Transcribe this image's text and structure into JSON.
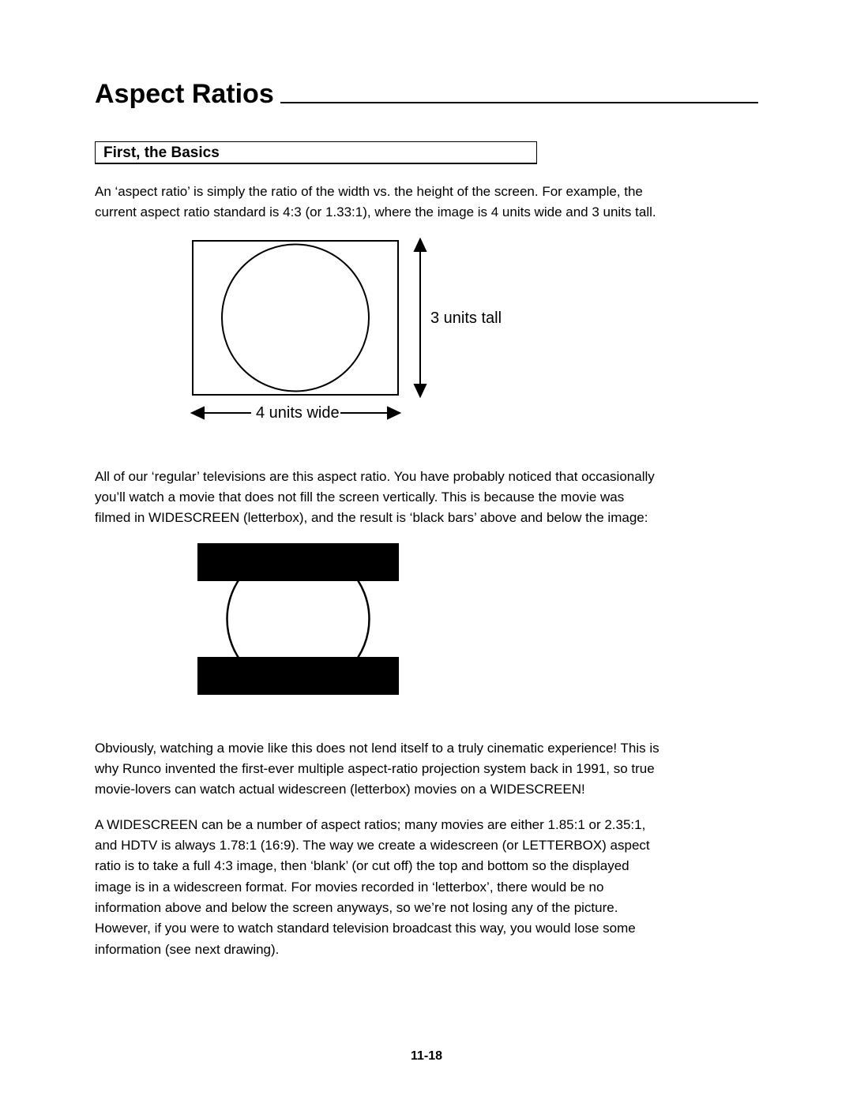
{
  "page": {
    "title": "Aspect Ratios",
    "section_heading": "First, the Basics",
    "para1": "An ‘aspect ratio’ is simply the ratio of the width vs. the height of the screen. For example, the current aspect ratio standard is 4:3 (or 1.33:1), where the image is 4 units wide and 3 units tall.",
    "diagram": {
      "height_label": "3 units tall",
      "width_label": "4 units wide"
    },
    "para2": "All of our ‘regular’ televisions are this aspect ratio. You have probably noticed that occasionally you’ll watch a movie that does not fill the screen vertically. This is because the movie was filmed in WIDESCREEN (letterbox), and the result is ‘black bars’ above and below the image:",
    "para3": "Obviously, watching a movie like this does not lend itself to a truly cinematic experience! This is why Runco invented the first-ever multiple aspect-ratio projection system back in 1991, so true movie-lovers can watch actual widescreen (letterbox) movies on a WIDESCREEN!",
    "para4": "A WIDESCREEN can be a number of aspect ratios; many movies are either 1.85:1 or 2.35:1, and HDTV is always 1.78:1 (16:9). The way we create a widescreen (or LETTERBOX) aspect ratio is to take a full 4:3 image, then ‘blank’ (or cut off) the top and bottom so the displayed image is in a widescreen format. For movies recorded in ‘letterbox’, there would be no information above and below the screen anyways, so we’re not losing any of the picture. However, if you were to watch standard television broadcast this way, you would lose some information (see next drawing).",
    "page_number": "11-18"
  }
}
